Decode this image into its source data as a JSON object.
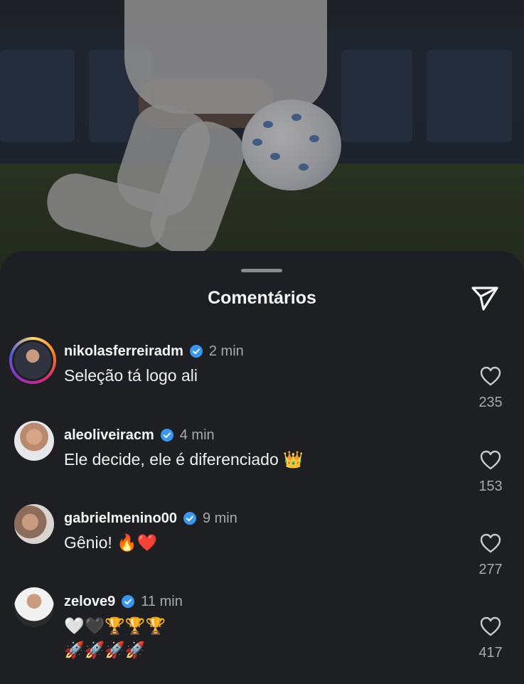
{
  "sheet": {
    "title": "Comentários"
  },
  "icons": {
    "send": "send-icon",
    "verified": "verified-badge-icon",
    "like": "heart-icon"
  },
  "colors": {
    "background": "#1e1f23",
    "verified": "#3897f0",
    "muted": "#a8a9ae"
  },
  "comments": [
    {
      "username": "nikolasferreiradm",
      "time": "2 min",
      "text": "Seleção tá logo ali",
      "likes": "235"
    },
    {
      "username": "aleoliveiracm",
      "time": "4 min",
      "text": "Ele decide, ele é diferenciado 👑",
      "likes": "153"
    },
    {
      "username": "gabrielmenino00",
      "time": "9 min",
      "text": "Gênio! 🔥❤️",
      "likes": "277"
    },
    {
      "username": "zelove9",
      "time": "11 min",
      "text": "🤍🖤🏆🏆🏆\n🚀🚀🚀🚀",
      "likes": "417"
    }
  ]
}
